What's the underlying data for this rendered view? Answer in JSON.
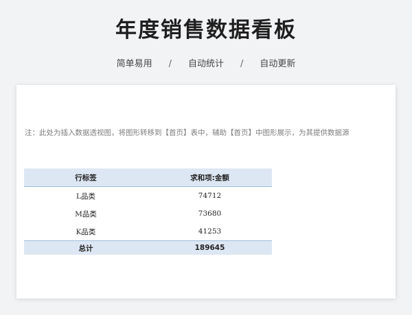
{
  "header": {
    "title": "年度销售数据看板",
    "tags": [
      "简单易用",
      "自动统计",
      "自动更新"
    ],
    "separator": "/"
  },
  "sheet": {
    "note": "注：此处为插入数据透视图，将图形转移到【首页】表中，辅助【首页】中图形展示，为其提供数据源",
    "pivot": {
      "headers": [
        "行标签",
        "求和项:金额"
      ],
      "rows": [
        {
          "label": "L品类",
          "value": "74712"
        },
        {
          "label": "M品类",
          "value": "73680"
        },
        {
          "label": "K品类",
          "value": "41253"
        }
      ],
      "total": {
        "label": "总计",
        "value": "189645"
      }
    }
  },
  "colors": {
    "page_background": "#f2f3f5",
    "header_fill": "#dde7f3",
    "header_border": "#9fbbd9"
  }
}
